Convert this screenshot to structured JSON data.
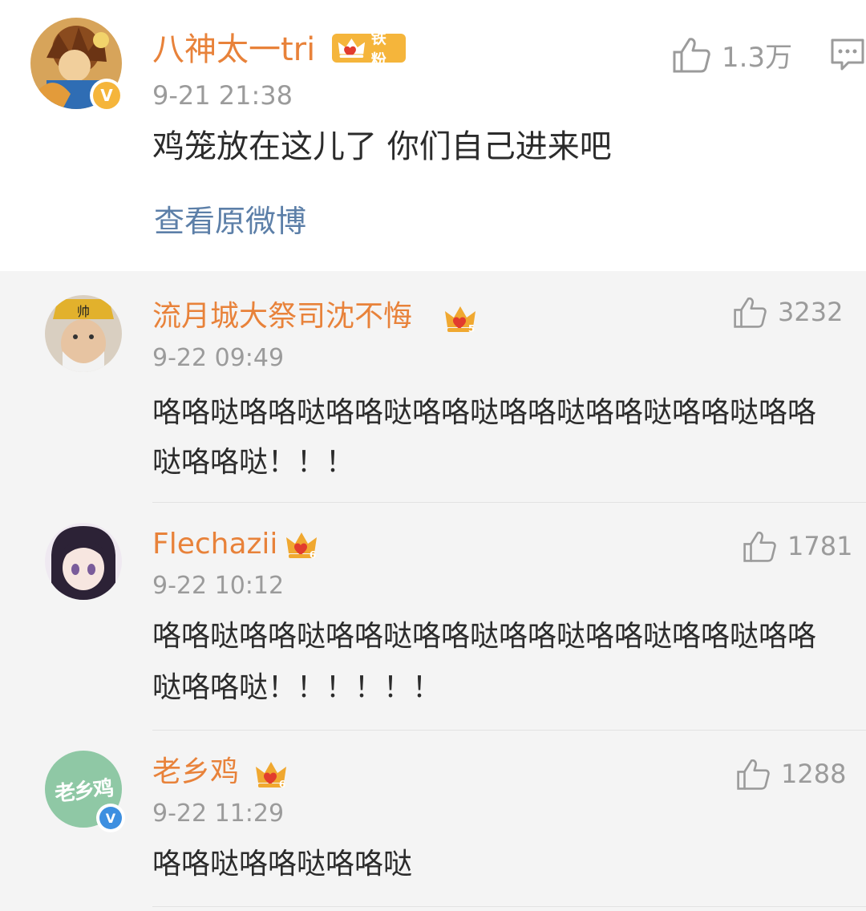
{
  "post": {
    "username": "八神太一tri",
    "fan_badge": "铁粉",
    "time": "9-21 21:38",
    "text": "鸡笼放在这儿了 你们自己进来吧",
    "likes": "1.3万",
    "view_original": "查看原微博"
  },
  "comments": [
    {
      "username": "流月城大祭司沈不悔",
      "level": "5",
      "time": "9-22 09:49",
      "text_line1": "咯咯哒咯咯哒咯咯哒咯咯哒咯咯哒咯咯哒咯咯哒咯咯",
      "text_line2": "哒咯咯哒！！！",
      "likes": "3232"
    },
    {
      "username": "Flechazii",
      "level": "6",
      "time": "9-22 10:12",
      "text_line1": "咯咯哒咯咯哒咯咯哒咯咯哒咯咯哒咯咯哒咯咯哒咯咯",
      "text_line2": "哒咯咯哒！！！！！！",
      "likes": "1781"
    },
    {
      "username": "老乡鸡",
      "level": "6",
      "time": "9-22 11:29",
      "text_line1": "咯咯哒咯咯哒咯咯哒",
      "likes": "1288",
      "avatar_text": "老乡鸡"
    }
  ],
  "colors": {
    "username": "#e8823a",
    "timestamp": "#9b9b9b",
    "link": "#5c7fa8",
    "crown": "#f0a830",
    "verified_gold": "#f5b53b",
    "verified_blue": "#3d8fe0",
    "laoxiangji_avatar": "#8fc8a5"
  },
  "icons": {
    "like": "thumbs-up-icon",
    "comment": "comment-icon",
    "crown": "crown-icon",
    "verified": "verified-badge-icon"
  }
}
